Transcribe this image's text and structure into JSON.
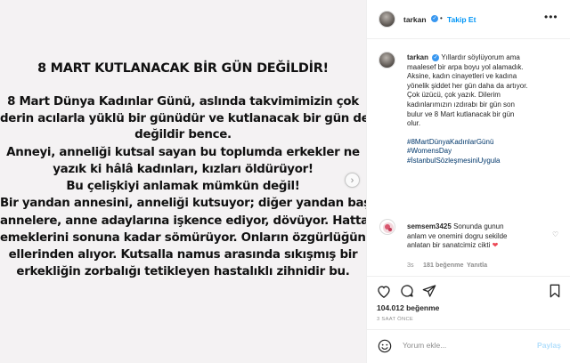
{
  "post": {
    "headline": "8 MART KUTLANACAK BİR GÜN DEĞİLDİR!",
    "lines": [
      "8 Mart Dünya Kadınlar Günü, aslında takvimimizin çok",
      "derin acılarla yüklü bir günüdür ve kutlanacak bir gün de",
      "değildir bence.",
      "Anneyi, anneliği kutsal sayan bu toplumda erkekler ne",
      "yazık ki hâlâ kadınları, kızları öldürüyor!",
      "Bu çelişkiyi anlamak mümkün değil!",
      "Bir yandan annesini, anneliği kutsuyor; diğer yandan başka",
      "annelere, anne adaylarına işkence ediyor, dövüyor. Hatta",
      "emeklerini sonuna kadar sömürüyor. Onların özgürlüğünü",
      "ellerinden alıyor. Kutsalla namus arasında sıkışmış bir",
      "erkekliğin zorbalığı tetikleyen hastalıklı zihnidir bu."
    ]
  },
  "header": {
    "username": "tarkan",
    "separator": "•",
    "follow": "Takip Et",
    "more": "•••"
  },
  "caption": {
    "username": "tarkan",
    "text_lines": [
      "Yıllardır söylüyorum ama",
      "maalesef bir arpa boyu yol alamadık.",
      "Aksine, kadın cinayetleri ve kadına",
      "yönelik şiddet her gün daha da artıyor.",
      "Çok üzücü, çok yazık. Dilerim",
      "kadınlarımızın ızdırabı bir gün son",
      "bulur ve 8 Mart kutlanacak bir gün",
      "olur."
    ],
    "hashtags": [
      "#8MartDünyaKadınlarGünü",
      "#WomensDay",
      "#İstanbulSözleşmesiniUygula"
    ]
  },
  "comment": {
    "username": "semsem3425",
    "text_lines": [
      "Sonunda gunun",
      "anlam ve onemini dogru sekilde",
      "anlatan bir sanatcimiz cikti"
    ],
    "heart": "❤",
    "time": "3s",
    "likes": "181 beğenme",
    "reply": "Yanıtla"
  },
  "stats": {
    "likes": "104.012 beğenme",
    "time_ago": "3 SAAT ÖNCE"
  },
  "add_comment": {
    "placeholder": "Yorum ekle...",
    "post": "Paylaş"
  },
  "colors": {
    "accent": "#0095f6",
    "verified": "#3897f0",
    "hashtag": "#00376b",
    "muted": "#8e8e8e",
    "image_bg": "#f4f2f3"
  }
}
